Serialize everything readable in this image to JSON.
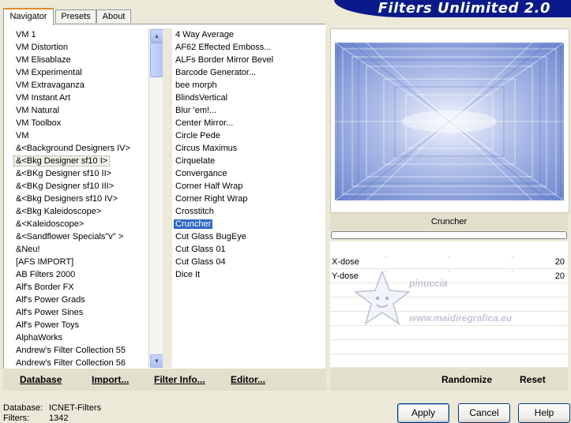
{
  "app": {
    "title": "Filters Unlimited 2.0"
  },
  "tabs": [
    {
      "label": "Navigator",
      "active": true
    },
    {
      "label": "Presets",
      "active": false
    },
    {
      "label": "About",
      "active": false
    }
  ],
  "categories": {
    "items": [
      "VM 1",
      "VM Distortion",
      "VM Elisablaze",
      "VM Experimental",
      "VM Extravaganza",
      "VM Instant Art",
      "VM Natural",
      "VM Toolbox",
      "VM",
      "&<Background Designers IV>",
      "&<Bkg Designer sf10 I>",
      "&<BKg Designer sf10 II>",
      "&<BKg Designer sf10 III>",
      "&<Bkg Designers sf10 IV>",
      "&<Bkg Kaleidoscope>",
      "&<Kaleidoscope>",
      "&<Sandflower Specials\"v\" >",
      "&Neu!",
      "[AFS IMPORT]",
      "AB Filters 2000",
      "Alf's Border FX",
      "Alf's Power Grads",
      "Alf's Power Sines",
      "Alf's Power Toys",
      "AlphaWorks",
      "Andrew's Filter Collection 55",
      "Andrew's Filter Collection 56"
    ],
    "focused_index": 10
  },
  "filters": {
    "items": [
      "4 Way Average",
      "AF62 Effected Emboss...",
      "ALFs Border Mirror Bevel",
      "Barcode Generator...",
      "bee morph",
      "BlindsVertical",
      "Blur 'em!...",
      "Center Mirror...",
      "Circle Pede",
      "Circus Maximus",
      "Cirquelate",
      "Convergance",
      "Corner Half Wrap",
      "Corner Right Wrap",
      "Crosstitch",
      "Cruncher",
      "Cut Glass  BugEye",
      "Cut Glass 01",
      "Cut Glass 04",
      "Dice It"
    ],
    "selected_index": 15
  },
  "left_toolbar": {
    "database": "Database",
    "import": "Import...",
    "filter_info": "Filter Info...",
    "editor": "Editor..."
  },
  "preview": {
    "filter_name": "Cruncher",
    "progress": 0
  },
  "params": [
    {
      "label": "X-dose",
      "value": "20"
    },
    {
      "label": "Y-dose",
      "value": "20"
    }
  ],
  "right_toolbar": {
    "randomize": "Randomize",
    "reset": "Reset"
  },
  "status": {
    "database_label": "Database:",
    "database_value": "ICNET-Filters",
    "filters_label": "Filters:",
    "filters_value": "1342"
  },
  "buttons": {
    "apply": "Apply",
    "cancel": "Cancel",
    "help": "Help"
  },
  "watermark": {
    "line1": "pinuccia",
    "line2": "www.maidiregrafica.eu"
  },
  "colors": {
    "selection": "#316ac5",
    "banner": "#0a1a8a",
    "preview_tint": "#8fa6e0"
  }
}
